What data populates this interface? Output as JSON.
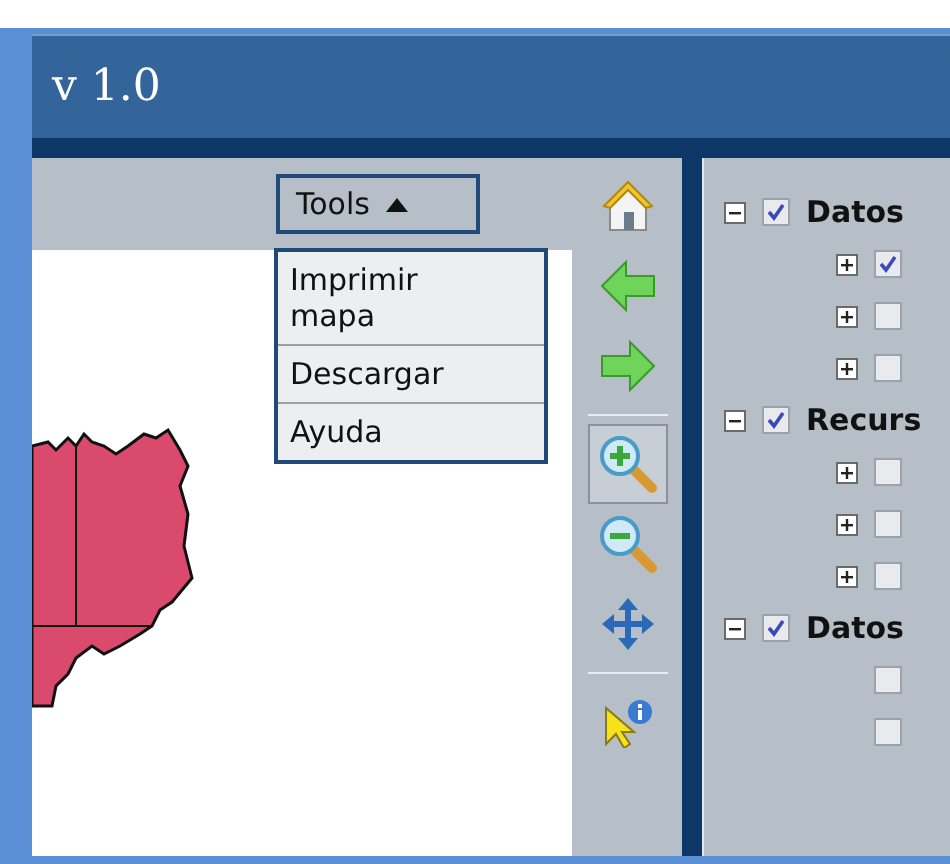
{
  "header": {
    "title": "v 1.0"
  },
  "tools_menu": {
    "label": "Tools",
    "expanded": true,
    "items": [
      "Imprimir\nmapa",
      "Descargar",
      "Ayuda"
    ]
  },
  "map_tools": [
    {
      "kind": "home",
      "selected": false
    },
    {
      "kind": "back",
      "selected": false
    },
    {
      "kind": "forward",
      "selected": false
    },
    {
      "kind": "zoom-in",
      "selected": true
    },
    {
      "kind": "zoom-out",
      "selected": false
    },
    {
      "kind": "pan",
      "selected": false
    },
    {
      "kind": "identify",
      "selected": false
    }
  ],
  "layers": [
    {
      "label": "Datos",
      "expanded": true,
      "checked": true,
      "children": [
        {
          "kind": "node",
          "expanded": false,
          "checked": true
        },
        {
          "kind": "node",
          "expanded": false,
          "checked": false
        },
        {
          "kind": "node",
          "expanded": false,
          "checked": false
        }
      ]
    },
    {
      "label": "Recurs",
      "expanded": true,
      "checked": true,
      "children": [
        {
          "kind": "node",
          "expanded": false,
          "checked": false
        },
        {
          "kind": "node",
          "expanded": false,
          "checked": false
        },
        {
          "kind": "node",
          "expanded": false,
          "checked": false
        }
      ]
    },
    {
      "label": "Datos",
      "expanded": true,
      "checked": true,
      "children": [
        {
          "kind": "leaf",
          "checked": false
        },
        {
          "kind": "leaf",
          "checked": false
        }
      ]
    }
  ]
}
